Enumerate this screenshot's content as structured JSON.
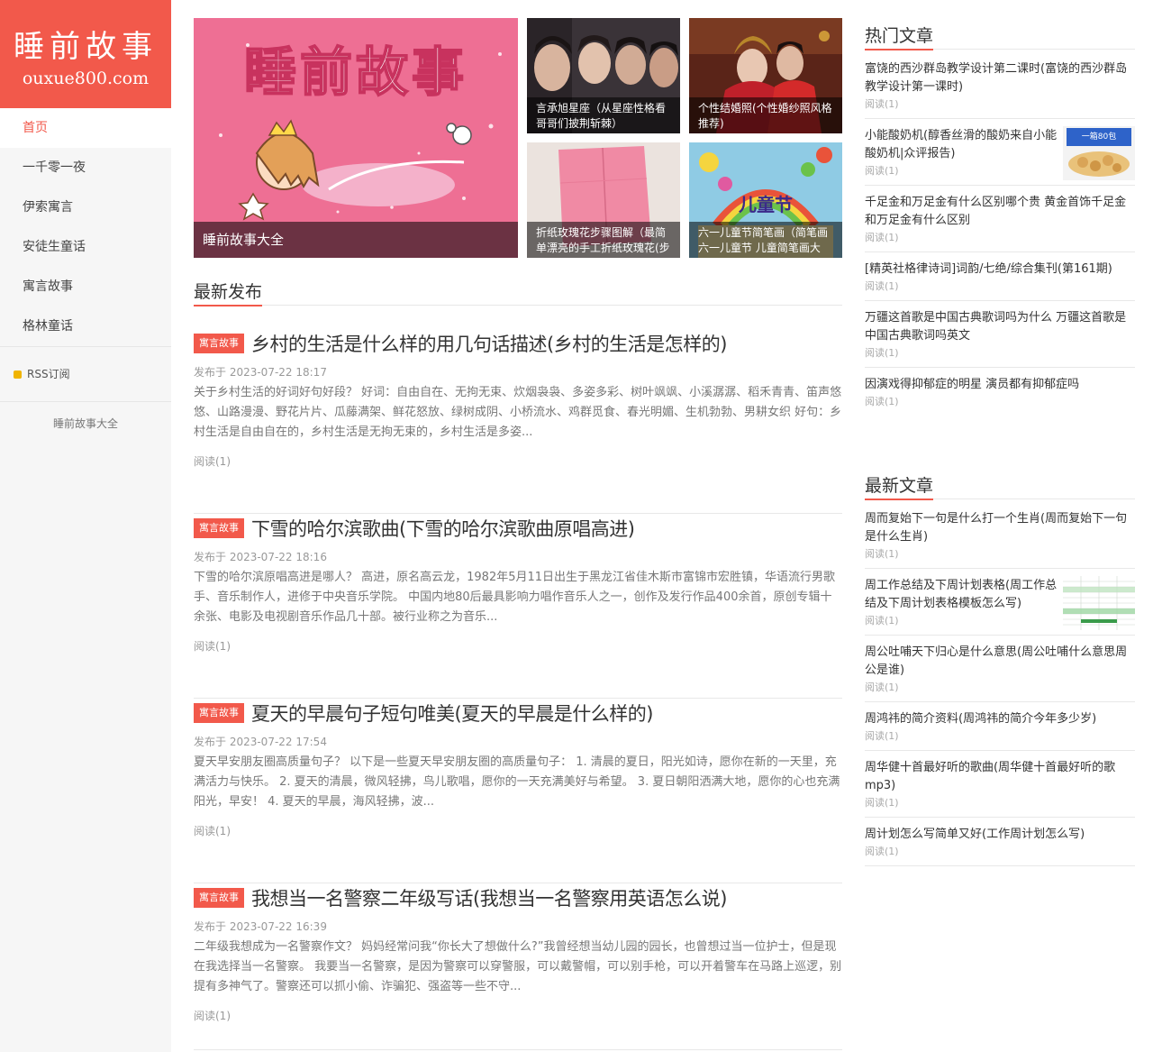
{
  "sidebar": {
    "logo_title": "睡前故事",
    "logo_sub": "ouxue800.com",
    "nav": [
      "首页",
      "一千零一夜",
      "伊索寓言",
      "安徒生童话",
      "寓言故事",
      "格林童话"
    ],
    "rss": "RSS订阅",
    "link": "睡前故事大全"
  },
  "features": {
    "big_caption": "睡前故事大全",
    "big_image_text": "睡前故事",
    "s1_caption": "言承旭星座（从星座性格看哥哥们披荆斩棘）",
    "s2_caption": "个性结婚照(个性婚纱照风格推荐)",
    "s3_caption": "折纸玫瑰花步骤图解（最简单漂亮的手工折纸玫瑰花(步",
    "s4_caption": "六一儿童节简笔画（简笔画六一儿童节 儿童简笔画大",
    "s4_image_text": "儿童节"
  },
  "latest_heading": "最新发布",
  "articles": [
    {
      "tag": "寓言故事",
      "title": "乡村的生活是什么样的用几句话描述(乡村的生活是怎样的)",
      "meta": "发布于 2023-07-22 18:17",
      "excerpt": "关于乡村生活的好词好句好段？ 好词：自由自在、无拘无束、炊烟袅袅、多姿多彩、树叶飒飒、小溪潺潺、稻禾青青、笛声悠悠、山路漫漫、野花片片、瓜藤满架、鲜花怒放、绿树成阴、小桥流水、鸡群觅食、春光明媚、生机勃勃、男耕女织 好句：乡村生活是自由自在的，乡村生活是无拘无束的，乡村生活是多姿...",
      "read": "阅读(1)"
    },
    {
      "tag": "寓言故事",
      "title": "下雪的哈尔滨歌曲(下雪的哈尔滨歌曲原唱高进)",
      "meta": "发布于 2023-07-22 18:16",
      "excerpt": "下雪的哈尔滨原唱高进是哪人？ 高进，原名高云龙，1982年5月11日出生于黑龙江省佳木斯市富锦市宏胜镇，华语流行男歌手、音乐制作人，进修于中央音乐学院。 中国内地80后最具影响力唱作音乐人之一，创作及发行作品400余首，原创专辑十余张、电影及电视剧音乐作品几十部。被行业称之为音乐...",
      "read": "阅读(1)"
    },
    {
      "tag": "寓言故事",
      "title": "夏天的早晨句子短句唯美(夏天的早晨是什么样的)",
      "meta": "发布于 2023-07-22 17:54",
      "excerpt": "夏天早安朋友圈高质量句子？ 以下是一些夏天早安朋友圈的高质量句子： 1. 清晨的夏日，阳光如诗，愿你在新的一天里，充满活力与快乐。 2. 夏天的清晨，微风轻拂，鸟儿歌唱，愿你的一天充满美好与希望。 3. 夏日朝阳洒满大地，愿你的心也充满阳光，早安！ 4. 夏天的早晨，海风轻拂，波...",
      "read": "阅读(1)"
    },
    {
      "tag": "寓言故事",
      "title": "我想当一名警察二年级写话(我想当一名警察用英语怎么说)",
      "meta": "发布于 2023-07-22 16:39",
      "excerpt": "二年级我想成为一名警察作文？ 妈妈经常问我“你长大了想做什么?”我曾经想当幼儿园的园长，也曾想过当一位护士，但是现在我选择当一名警察。 我要当一名警察，是因为警察可以穿警服，可以戴警帽，可以别手枪，可以开着警车在马路上巡逻，别提有多神气了。警察还可以抓小偷、诈骗犯、强盗等一些不守...",
      "read": "阅读(1)"
    }
  ],
  "hot": {
    "heading": "热门文章",
    "items": [
      {
        "title": "富饶的西沙群岛教学设计第二课时(富饶的西沙群岛教学设计第一课时)",
        "read": "阅读(1)"
      },
      {
        "title": "小能酸奶机(醇香丝滑的酸奶来自小能酸奶机|众评报告)",
        "read": "阅读(1)",
        "thumb_text": "一箱80包"
      },
      {
        "title": "千足金和万足金有什么区别哪个贵 黄金首饰千足金和万足金有什么区别",
        "read": "阅读(1)"
      },
      {
        "title": "[精英社格律诗词]词韵/七绝/综合集刊(第161期)",
        "read": "阅读(1)"
      },
      {
        "title": "万疆这首歌是中国古典歌词吗为什么 万疆这首歌是中国古典歌词吗英文",
        "read": "阅读(1)"
      },
      {
        "title": "因演戏得抑郁症的明星 演员都有抑郁症吗",
        "read": "阅读(1)"
      }
    ]
  },
  "newest": {
    "heading": "最新文章",
    "items": [
      {
        "title": "周而复始下一句是什么打一个生肖(周而复始下一句是什么生肖)",
        "read": "阅读(1)"
      },
      {
        "title": "周工作总结及下周计划表格(周工作总结及下周计划表格模板怎么写)",
        "read": "阅读(1)"
      },
      {
        "title": "周公吐哺天下归心是什么意思(周公吐哺什么意思周公是谁)",
        "read": "阅读(1)"
      },
      {
        "title": "周鸿祎的简介资料(周鸿祎的简介今年多少岁)",
        "read": "阅读(1)"
      },
      {
        "title": "周华健十首最好听的歌曲(周华健十首最好听的歌mp3)",
        "read": "阅读(1)"
      },
      {
        "title": "周计划怎么写简单又好(工作周计划怎么写)",
        "read": "阅读(1)"
      }
    ]
  },
  "colors": {
    "accent": "#f2594b",
    "sidebar_bg": "#f6f6f6"
  }
}
